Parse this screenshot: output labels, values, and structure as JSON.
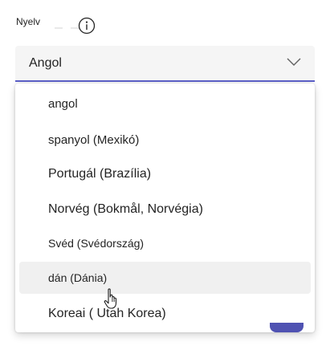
{
  "field": {
    "label": "Nyelv",
    "selected_value": "Angol",
    "info_icon": "info-icon",
    "chevron_icon": "chevron-down-icon"
  },
  "options": [
    "angol",
    "spanyol (Mexikó)",
    "Portugál (Brazília)",
    "Norvég (Bokmål, Norvégia)",
    "Svéd (Svédország)",
    "dán (Dánia)",
    "Koreai ( Utah Korea)"
  ],
  "hovered_option": "dán (Dánia)",
  "colors": {
    "accent": "#5b5fc7",
    "field_background": "#f5f5f5",
    "hover_background": "#f0f0f0",
    "text": "#242424"
  }
}
